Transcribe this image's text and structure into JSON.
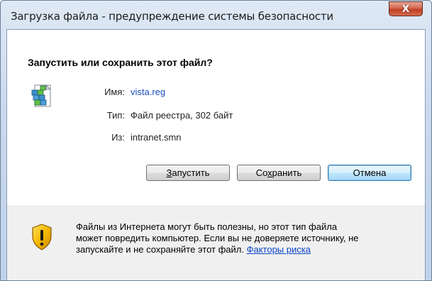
{
  "window": {
    "title": "Загрузка файла - предупреждение системы безопасности",
    "close_glyph": "X"
  },
  "dialog": {
    "question": "Запустить или сохранить этот файл?",
    "file_icon": "registry-file-icon",
    "fields": {
      "name_label": "Имя:",
      "name_value": "vista.reg",
      "type_label": "Тип:",
      "type_value": "Файл реестра, 302 байт",
      "from_label": "Из:",
      "from_value": "intranet.smn"
    },
    "buttons": {
      "run_accel": "З",
      "run_rest": "апустить",
      "save_before": "Со",
      "save_accel": "х",
      "save_after": "ранить",
      "cancel": "Отмена"
    }
  },
  "warning": {
    "icon": "security-shield-warning-icon",
    "line1": "Файлы из Интернета могут быть полезны, но этот тип файла",
    "line2": "может повредить компьютер. Если вы не доверяете источнику, не",
    "line3_prefix": "запускайте и не сохраняйте этот файл.",
    "risk_link": "Факторы риска"
  }
}
